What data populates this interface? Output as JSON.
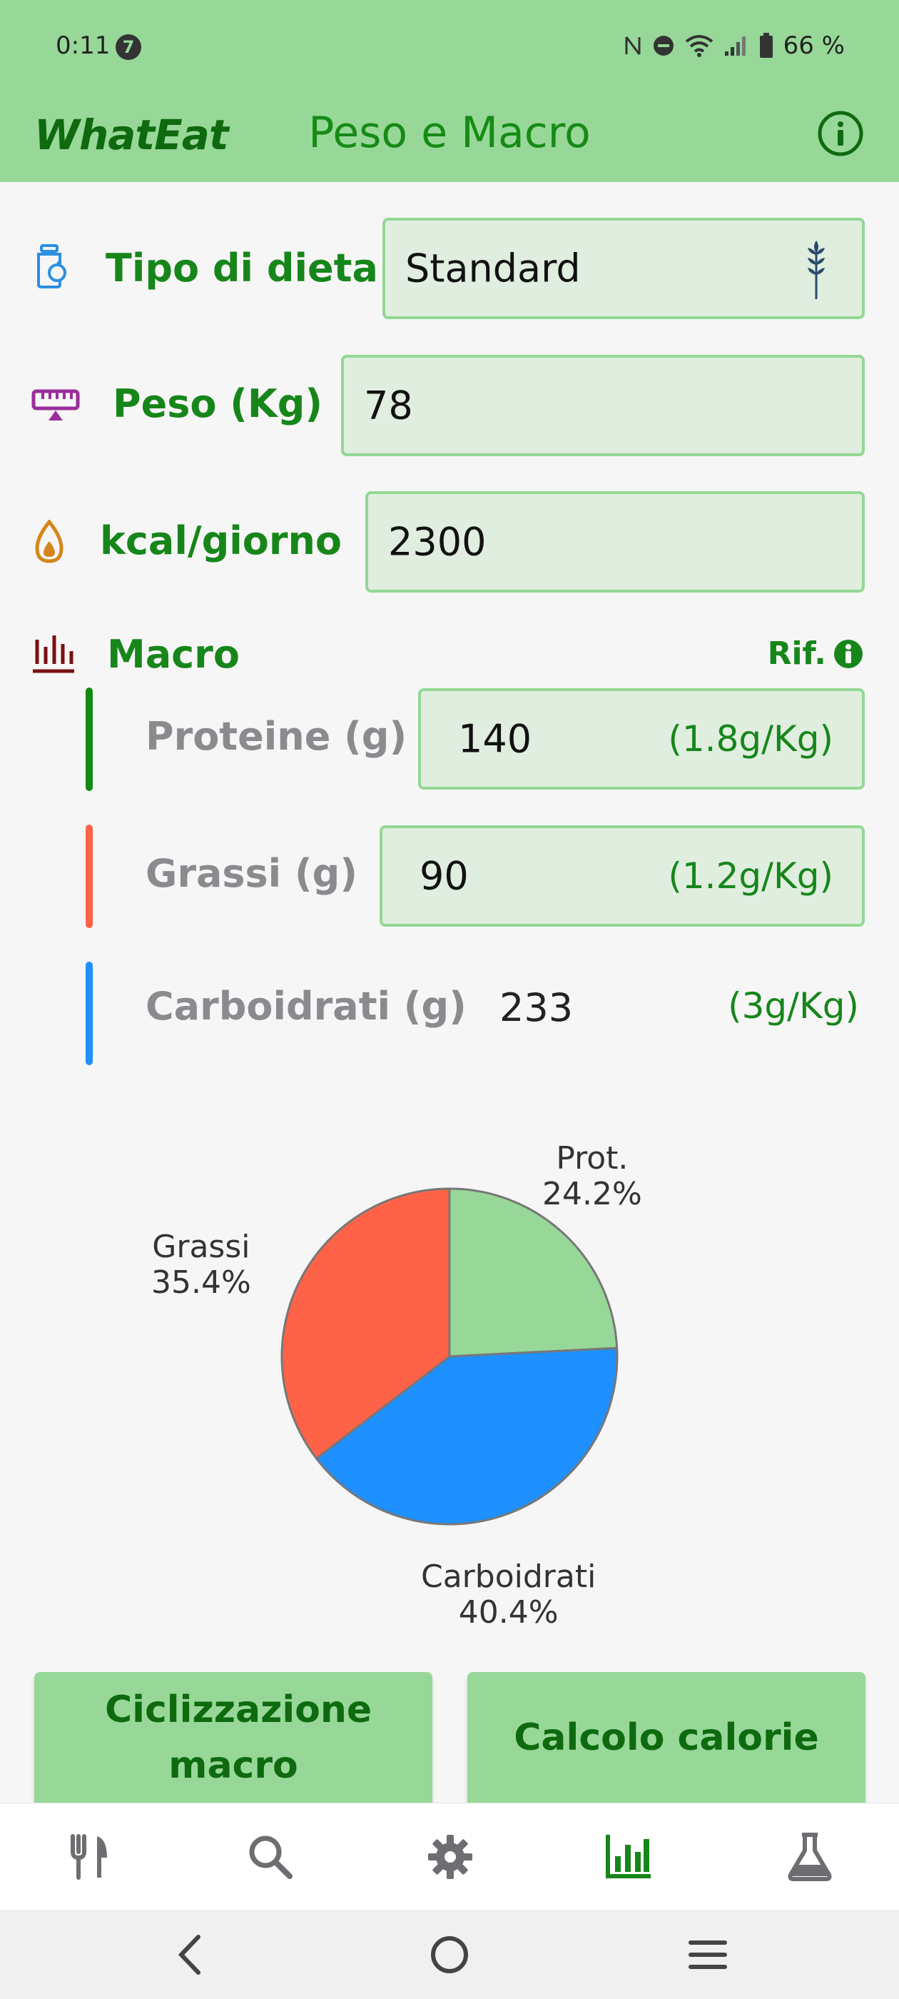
{
  "status": {
    "time": "0:11",
    "notification_count": "7",
    "battery": "66 %"
  },
  "app": {
    "logo": "WhatEat",
    "title": "Peso e Macro"
  },
  "form": {
    "diet_label": "Tipo di dieta",
    "diet_value": "Standard",
    "weight_label": "Peso (Kg)",
    "weight_value": "78",
    "kcal_label": "kcal/giorno",
    "kcal_value": "2300"
  },
  "macro": {
    "title": "Macro",
    "ref": "Rif.",
    "protein": {
      "label": "Proteine (g)",
      "value": "140",
      "per_kg": "(1.8g/Kg)"
    },
    "fat": {
      "label": "Grassi (g)",
      "value": "90",
      "per_kg": "(1.2g/Kg)"
    },
    "carbs": {
      "label": "Carboidrati (g)",
      "value": "233",
      "per_kg": "(3g/Kg)"
    }
  },
  "chart_data": {
    "type": "pie",
    "slices": [
      {
        "label": "Prot.",
        "percent_label": "24.2%",
        "value": 24.2,
        "color": "#97d898"
      },
      {
        "label": "Carboidrati",
        "percent_label": "40.4%",
        "value": 40.4,
        "color": "#1e90ff"
      },
      {
        "label": "Grassi",
        "percent_label": "35.4%",
        "value": 35.4,
        "color": "#ff6347"
      }
    ]
  },
  "buttons": {
    "cycling": "Ciclizzazione macro",
    "calories": "Calcolo calorie"
  },
  "colors": {
    "accent": "#97d898",
    "label_green": "#17861a",
    "protein": "#138a14",
    "fat": "#ff6347",
    "carbs": "#1e90ff"
  },
  "nav": {
    "items": [
      "fork-knife-icon",
      "search-icon",
      "gear-icon",
      "chart-bar-icon",
      "flask-icon"
    ],
    "active": "chart-bar-icon"
  }
}
